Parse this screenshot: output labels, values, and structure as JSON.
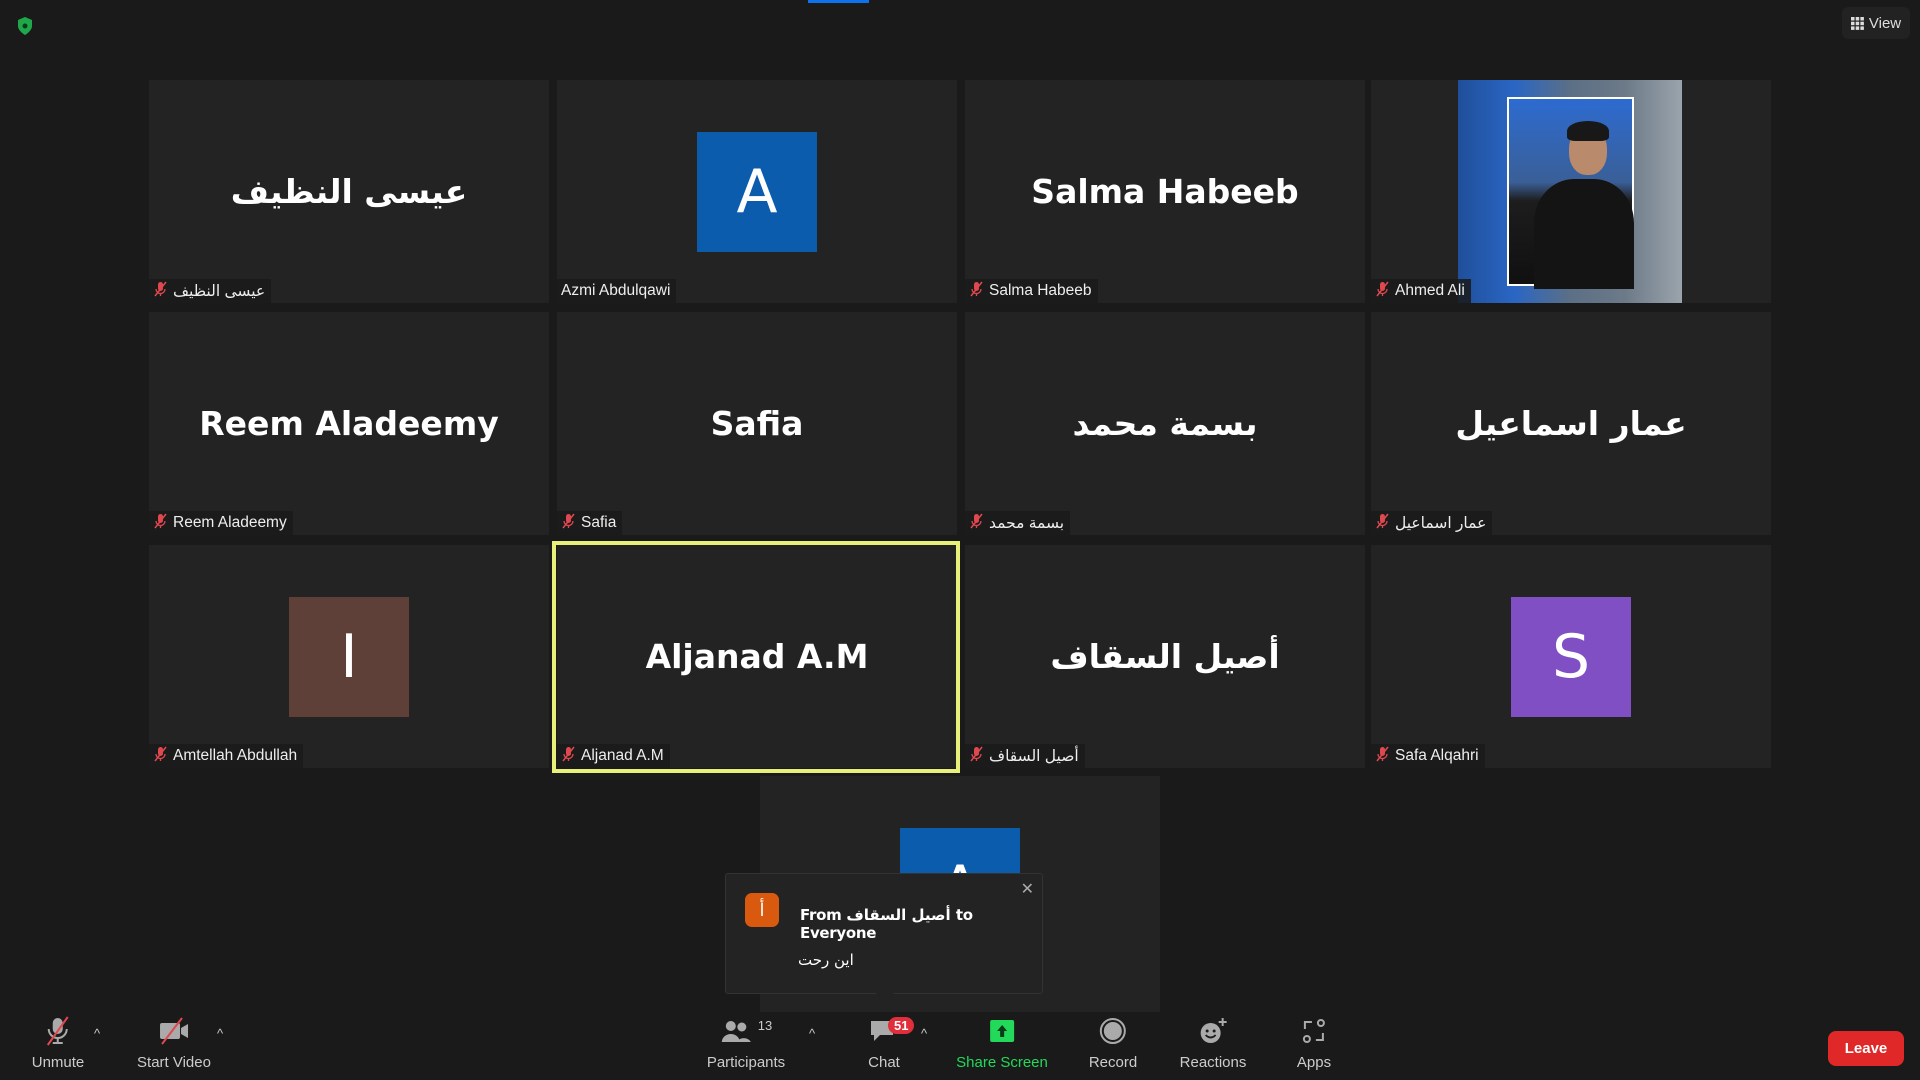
{
  "top": {
    "view_label": "View",
    "security_icon": "shield-icon"
  },
  "tiles": [
    {
      "big_name": "عيسى النظيف",
      "label": "عيسى النظيف",
      "muted": true
    },
    {
      "avatar_letter": "A",
      "avatar_color": "#0b5cad",
      "label": "Azmi Abdulqawi",
      "muted": false
    },
    {
      "big_name": "Salma Habeeb",
      "label": "Salma Habeeb",
      "muted": true
    },
    {
      "video": true,
      "label": "Ahmed Ali",
      "muted": true
    },
    {
      "big_name": "Reem Aladeemy",
      "label": "Reem Aladeemy",
      "muted": true
    },
    {
      "big_name": "Safia",
      "label": "Safia",
      "muted": true
    },
    {
      "big_name": "بسمة محمد",
      "label": "بسمة محمد",
      "muted": true
    },
    {
      "big_name": "عمار اسماعيل",
      "label": "عمار اسماعيل",
      "muted": true
    },
    {
      "avatar_letter": "I",
      "avatar_color": "#5e4038",
      "label": "Amtellah Abdullah",
      "muted": true
    },
    {
      "big_name": "Aljanad A.M",
      "label": "Aljanad A.M",
      "muted": true,
      "active_speaker": true
    },
    {
      "big_name": "أصيل السقاف",
      "label": "أصيل السقاف",
      "muted": true
    },
    {
      "avatar_letter": "S",
      "avatar_color": "#7f4fc3",
      "label": "Safa Alqahri",
      "muted": true
    },
    {
      "avatar_letter": "A",
      "avatar_color": "#0b5cad"
    }
  ],
  "chat_popup": {
    "avatar_letter": "أ",
    "from_text": "From أصيل السقاف to Everyone",
    "message": "اين رحت"
  },
  "toolbar": {
    "unmute": "Unmute",
    "start_video": "Start Video",
    "participants": "Participants",
    "participants_count": "13",
    "chat": "Chat",
    "chat_badge": "51",
    "share_screen": "Share Screen",
    "record": "Record",
    "reactions": "Reactions",
    "apps": "Apps",
    "leave": "Leave"
  },
  "colors": {
    "share_green": "#23d959",
    "leave_red": "#e02828",
    "speaker_highlight": "#e8f07a",
    "muted_red": "#e0484f"
  }
}
